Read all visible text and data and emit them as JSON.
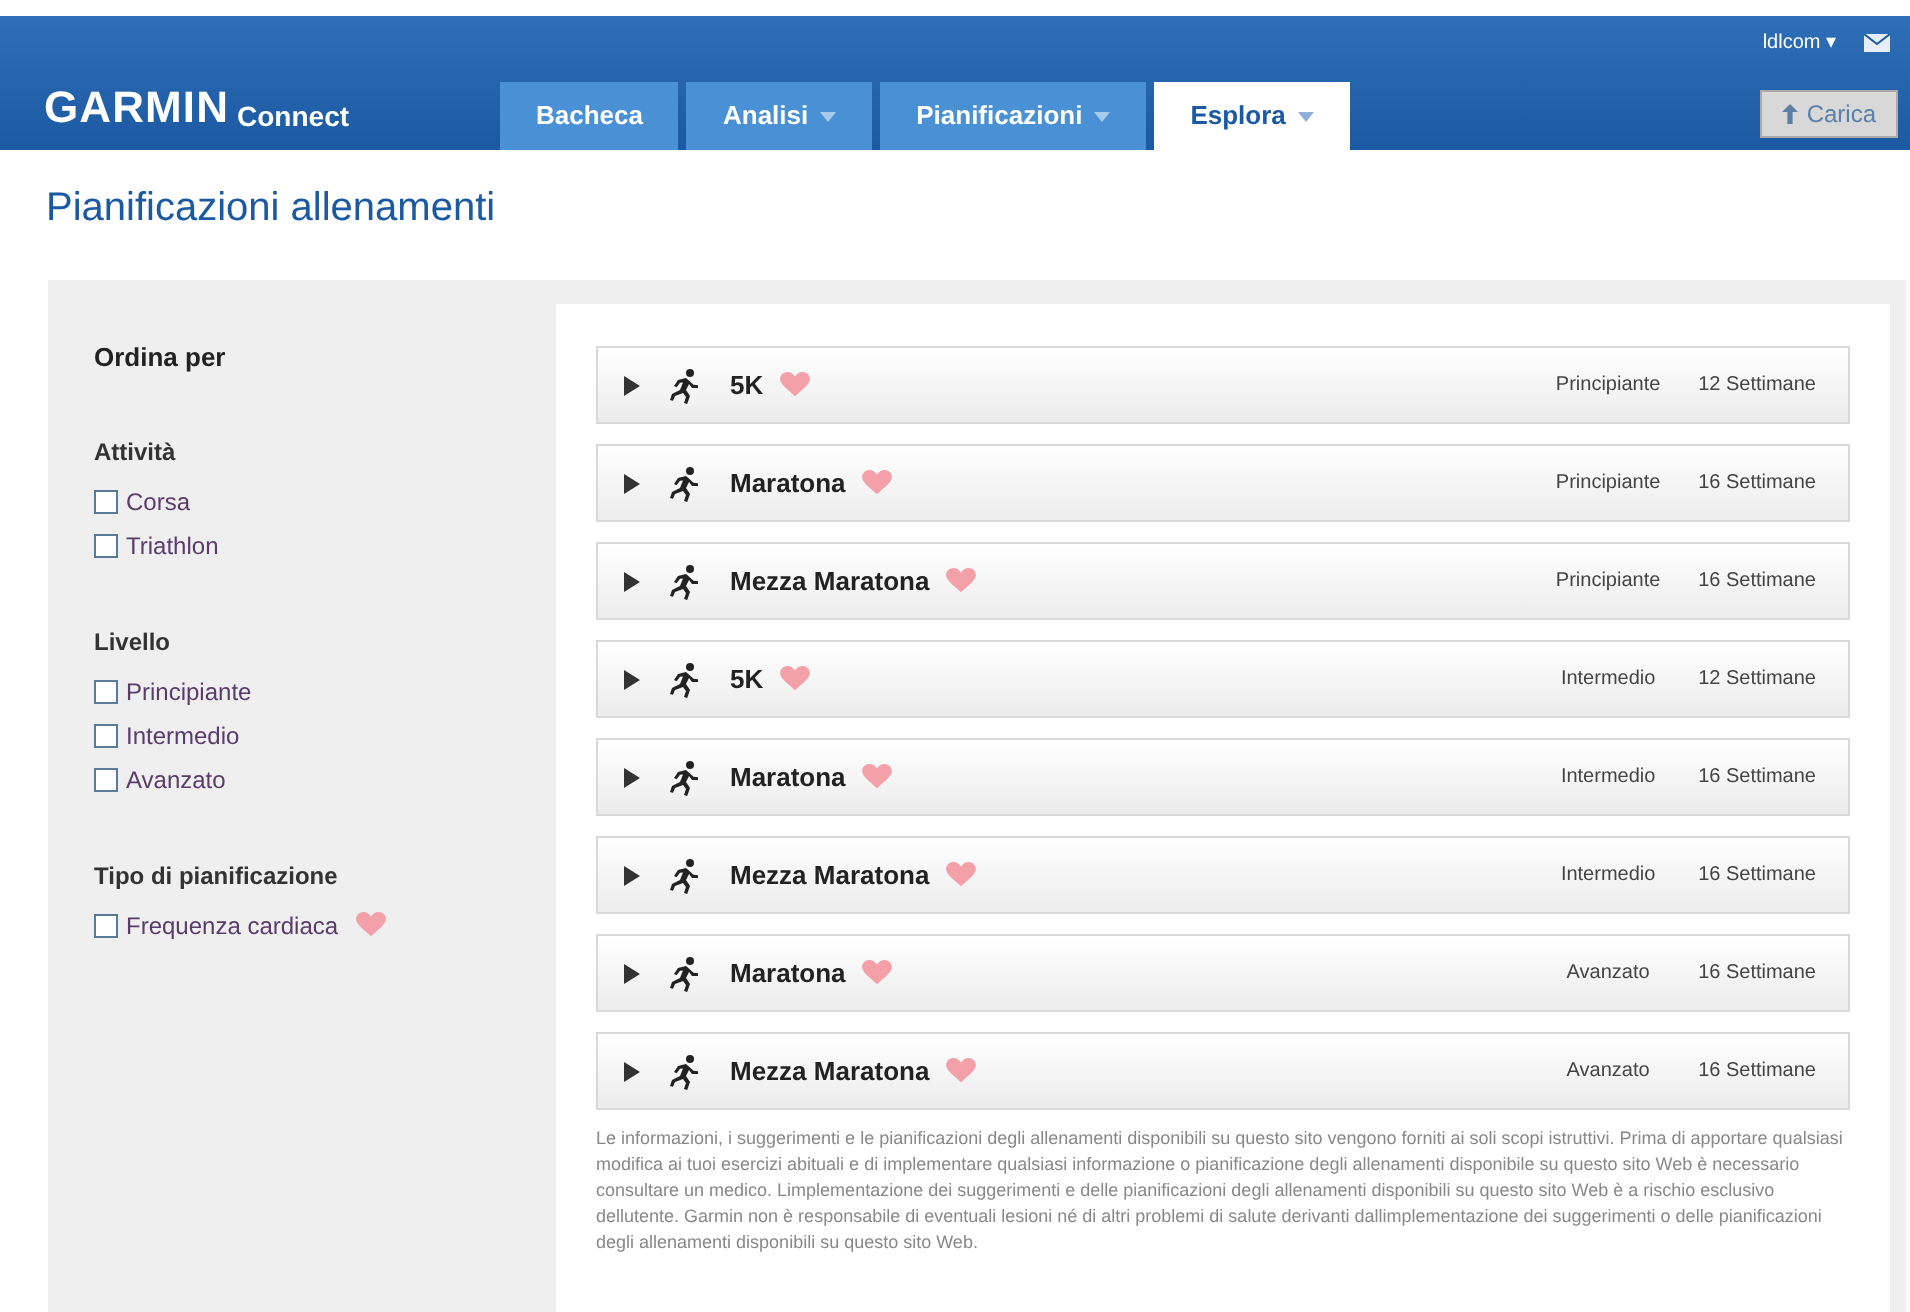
{
  "header": {
    "logo": "GARMIN",
    "logo_suffix": "Connect",
    "user_menu": "ldlcom ▾",
    "tabs": [
      {
        "label": "Bacheca",
        "dropdown": false,
        "selected": false
      },
      {
        "label": "Analisi",
        "dropdown": true,
        "selected": false
      },
      {
        "label": "Pianificazioni",
        "dropdown": true,
        "selected": false
      },
      {
        "label": "Esplora",
        "dropdown": true,
        "selected": true
      }
    ],
    "upload_button": "Carica"
  },
  "page_title": "Pianificazioni allenamenti",
  "sidebar": {
    "title": "Ordina per",
    "groups": [
      {
        "title": "Attività",
        "options": [
          {
            "label": "Corsa",
            "checked": false,
            "heart": false
          },
          {
            "label": "Triathlon",
            "checked": false,
            "heart": false
          }
        ]
      },
      {
        "title": "Livello",
        "options": [
          {
            "label": "Principiante",
            "checked": false,
            "heart": false
          },
          {
            "label": "Intermedio",
            "checked": false,
            "heart": false
          },
          {
            "label": "Avanzato",
            "checked": false,
            "heart": false
          }
        ]
      },
      {
        "title": "Tipo di pianificazione",
        "options": [
          {
            "label": "Frequenza cardiaca",
            "checked": false,
            "heart": true
          }
        ]
      }
    ]
  },
  "plans": [
    {
      "name": "5K",
      "heart": true,
      "level": "Principiante",
      "duration": "12 Settimane"
    },
    {
      "name": "Maratona",
      "heart": true,
      "level": "Principiante",
      "duration": "16 Settimane"
    },
    {
      "name": "Mezza Maratona",
      "heart": true,
      "level": "Principiante",
      "duration": "16 Settimane"
    },
    {
      "name": "5K",
      "heart": true,
      "level": "Intermedio",
      "duration": "12 Settimane"
    },
    {
      "name": "Maratona",
      "heart": true,
      "level": "Intermedio",
      "duration": "16 Settimane"
    },
    {
      "name": "Mezza Maratona",
      "heart": true,
      "level": "Intermedio",
      "duration": "16 Settimane"
    },
    {
      "name": "Maratona",
      "heart": true,
      "level": "Avanzato",
      "duration": "16 Settimane"
    },
    {
      "name": "Mezza Maratona",
      "heart": true,
      "level": "Avanzato",
      "duration": "16 Settimane"
    }
  ],
  "disclaimer": "Le informazioni, i suggerimenti e le pianificazioni degli allenamenti disponibili su questo sito vengono forniti ai soli scopi istruttivi. Prima di apportare qualsiasi modifica ai tuoi esercizi abituali e di implementare qualsiasi informazione o pianificazione degli allenamenti disponibile su questo sito Web è necessario consultare un medico. Limplementazione dei suggerimenti e delle pianificazioni degli allenamenti disponibili su questo sito Web è a rischio esclusivo dellutente. Garmin non è responsabile di eventuali lesioni né di altri problemi di salute derivanti dallimplementazione dei suggerimenti o delle pianificazioni degli allenamenti disponibili su questo sito Web."
}
